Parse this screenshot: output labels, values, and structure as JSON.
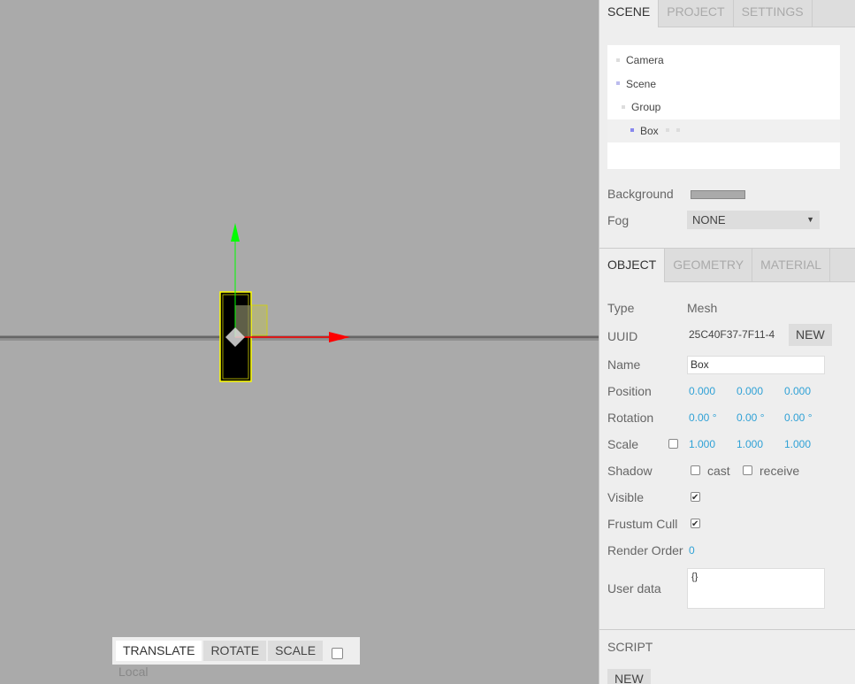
{
  "viewport": {
    "toolbar": {
      "translate": "TRANSLATE",
      "rotate": "ROTATE",
      "scale": "SCALE",
      "local_label": "Local",
      "local_checked": false
    },
    "gizmo_colors": {
      "x_axis": "#ff0000",
      "y_axis": "#00ff00",
      "selection": "#ffff00"
    }
  },
  "sidebar": {
    "top_tabs": [
      {
        "label": "SCENE",
        "active": true
      },
      {
        "label": "PROJECT",
        "active": false
      },
      {
        "label": "SETTINGS",
        "active": false
      }
    ],
    "outliner": [
      {
        "label": "Camera",
        "type": "camera",
        "selected": false
      },
      {
        "label": "Scene",
        "type": "scene",
        "selected": false
      },
      {
        "label": "Group",
        "type": "group",
        "selected": false
      },
      {
        "label": "Box",
        "type": "mesh",
        "selected": true
      }
    ],
    "scene_settings": {
      "background_label": "Background",
      "background_color": "#aaaaaa",
      "fog_label": "Fog",
      "fog_value": "NONE"
    },
    "object_tabs": [
      {
        "label": "OBJECT",
        "active": true
      },
      {
        "label": "GEOMETRY",
        "active": false
      },
      {
        "label": "MATERIAL",
        "active": false
      }
    ],
    "object": {
      "type_label": "Type",
      "type_value": "Mesh",
      "uuid_label": "UUID",
      "uuid_value": "25C40F37-7F11-4",
      "uuid_new": "NEW",
      "name_label": "Name",
      "name_value": "Box",
      "position_label": "Position",
      "position": [
        "0.000",
        "0.000",
        "0.000"
      ],
      "rotation_label": "Rotation",
      "rotation": [
        "0.00 °",
        "0.00 °",
        "0.00 °"
      ],
      "scale_label": "Scale",
      "scale_lock": false,
      "scale": [
        "1.000",
        "1.000",
        "1.000"
      ],
      "shadow_label": "Shadow",
      "shadow_cast_label": "cast",
      "shadow_cast": false,
      "shadow_receive_label": "receive",
      "shadow_receive": false,
      "visible_label": "Visible",
      "visible": true,
      "frustum_label": "Frustum Cull",
      "frustum": true,
      "render_order_label": "Render Order",
      "render_order": "0",
      "userdata_label": "User data",
      "userdata_value": "{}"
    },
    "script": {
      "title": "SCRIPT",
      "new": "NEW"
    }
  }
}
